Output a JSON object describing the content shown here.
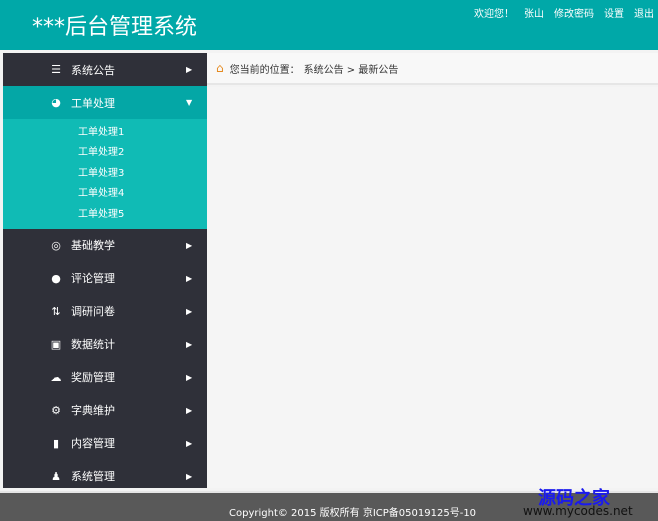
{
  "header": {
    "title": "***后台管理系统",
    "nav": [
      "欢迎您！",
      "张山",
      "修改密码",
      "设置",
      "退出"
    ]
  },
  "sidebar": {
    "items": [
      {
        "label": "系统公告",
        "icon": "stack-icon",
        "glyph": "☰"
      },
      {
        "label": "工单处理",
        "icon": "chart-circle-icon",
        "glyph": "◕",
        "open": true,
        "children": [
          "工单处理1",
          "工单处理2",
          "工单处理3",
          "工单处理4",
          "工单处理5"
        ]
      },
      {
        "label": "基础教学",
        "icon": "target-icon",
        "glyph": "◎"
      },
      {
        "label": "评论管理",
        "icon": "app-icon",
        "glyph": "●"
      },
      {
        "label": "调研问卷",
        "icon": "sort-arrows-icon",
        "glyph": "⇅"
      },
      {
        "label": "数据统计",
        "icon": "monitor-icon",
        "glyph": "▣"
      },
      {
        "label": "奖励管理",
        "icon": "cloud-icon",
        "glyph": "☁"
      },
      {
        "label": "字典维护",
        "icon": "gear-icon",
        "glyph": "⚙"
      },
      {
        "label": "内容管理",
        "icon": "notebook-icon",
        "glyph": "▮"
      },
      {
        "label": "系统管理",
        "icon": "user-gear-icon",
        "glyph": "♟"
      }
    ]
  },
  "breadcrumb": {
    "prefix": "您当前的位置：",
    "path": "系统公告 > 最新公告"
  },
  "footer": {
    "copyright": "Copyright© 2015 版权所有 京ICP备05019125号-10",
    "watermark_cn": "源码之家",
    "watermark_url": "www.mycodes.net"
  }
}
